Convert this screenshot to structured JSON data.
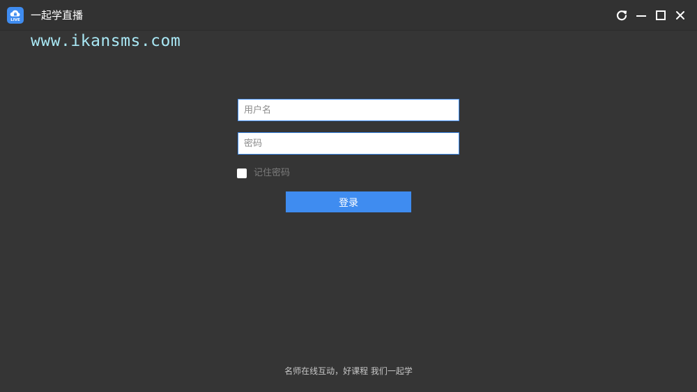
{
  "window": {
    "title": "一起学直播",
    "logo_icon": "live-cloud-icon",
    "logo_badge_text": "LIVE",
    "controls": [
      "refresh-icon",
      "minimize-icon",
      "maximize-icon",
      "close-icon"
    ]
  },
  "watermark": "www.ikansms.com",
  "login": {
    "username_placeholder": "用户名",
    "username_value": "",
    "password_placeholder": "密码",
    "password_value": "",
    "remember_label": "记住密码",
    "remember_checked": false,
    "submit_label": "登录"
  },
  "footer": {
    "slogan": "名师在线互动，好课程 我们一起学"
  },
  "colors": {
    "background": "#353535",
    "titlebar": "#323232",
    "accent": "#3f8cf0",
    "watermark": "#a9e8f5"
  }
}
